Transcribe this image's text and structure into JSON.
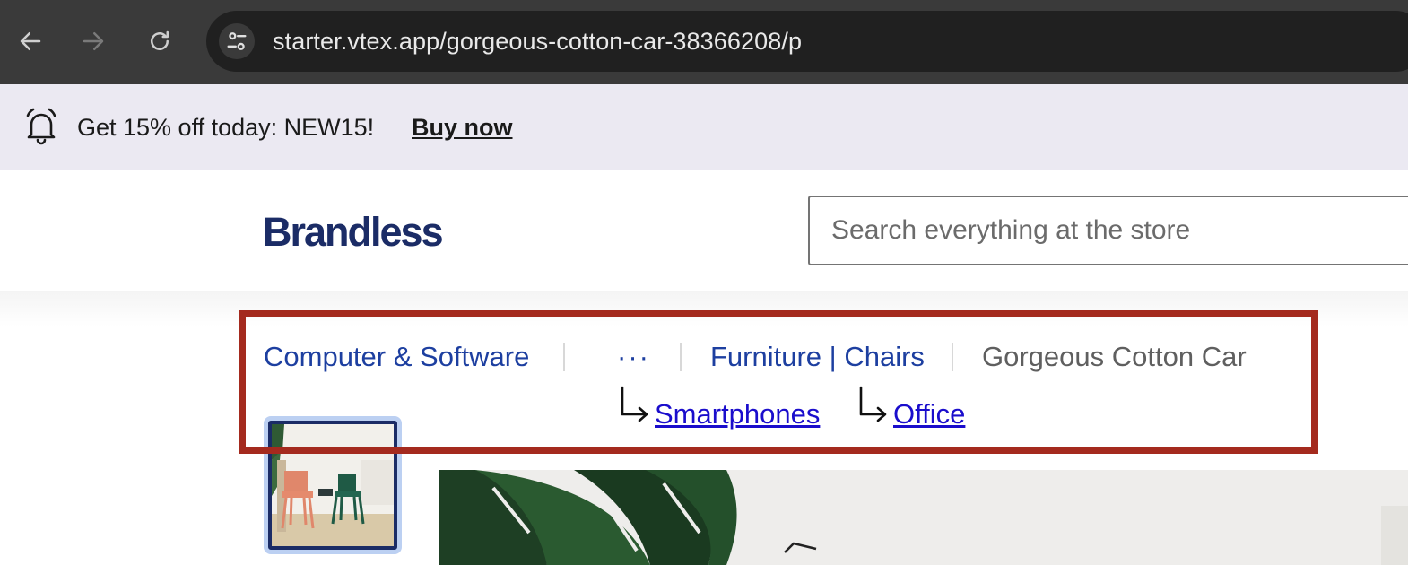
{
  "browser": {
    "url": "starter.vtex.app/gorgeous-cotton-car-38366208/p"
  },
  "promo": {
    "text": "Get 15% off today: NEW15!",
    "link": "Buy now"
  },
  "header": {
    "logo": "Brandless",
    "search_placeholder": "Search everything at the store"
  },
  "breadcrumb": {
    "items": [
      {
        "label": "Computer & Software"
      },
      {
        "label": "···"
      },
      {
        "label": "Furniture | Chairs"
      },
      {
        "label": "Gorgeous Cotton Car"
      }
    ],
    "collapsed": [
      {
        "label": "Smartphones"
      },
      {
        "label": "Office"
      }
    ]
  },
  "colors": {
    "highlight": "#a42a1e",
    "link": "#1d3fa0",
    "logo": "#1b2c66",
    "promo_bg": "#ebe9f2"
  },
  "icons": {
    "back": "arrow-left-icon",
    "forward": "arrow-right-icon",
    "reload": "reload-icon",
    "site_info": "tune-icon",
    "bell": "bell-icon",
    "sub_arrow": "corner-down-right-icon"
  }
}
